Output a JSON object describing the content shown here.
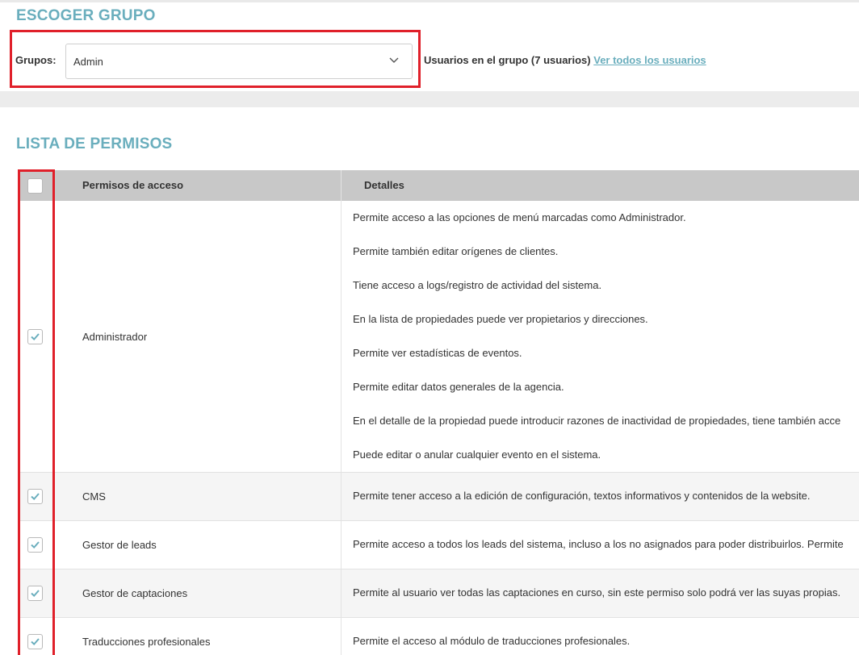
{
  "group_section": {
    "title": "ESCOGER GRUPO",
    "label": "Grupos:",
    "selected": "Admin",
    "users_text": "Usuarios en el grupo (7 usuarios)",
    "users_link": "Ver todos los usuarios"
  },
  "permissions_section": {
    "title": "LISTA DE PERMISOS",
    "headers": {
      "permission": "Permisos de acceso",
      "details": "Detalles"
    },
    "rows": [
      {
        "name": "Administrador",
        "checked": true,
        "details": [
          "Permite acceso a las opciones de menú marcadas como Administrador.",
          "Permite también editar orígenes de clientes.",
          "Tiene acceso a logs/registro de actividad del sistema.",
          "En la lista de propiedades puede ver propietarios y direcciones.",
          "Permite ver estadísticas de eventos.",
          "Permite editar datos generales de la agencia.",
          "En el detalle de la propiedad puede introducir razones de inactividad de propiedades, tiene también acce",
          "Puede editar o anular cualquier evento en el sistema."
        ]
      },
      {
        "name": "CMS",
        "checked": true,
        "details": [
          "Permite tener acceso a la edición de configuración, textos informativos y contenidos de la website."
        ]
      },
      {
        "name": "Gestor de leads",
        "checked": true,
        "details": [
          "Permite acceso a todos los leads del sistema, incluso a los no asignados para poder distribuirlos. Permite"
        ]
      },
      {
        "name": "Gestor de captaciones",
        "checked": true,
        "details": [
          "Permite al usuario ver todas las captaciones en curso, sin este permiso solo podrá ver las suyas propias."
        ]
      },
      {
        "name": "Traducciones profesionales",
        "checked": true,
        "details": [
          "Permite el acceso al módulo de traducciones profesionales."
        ]
      }
    ]
  },
  "colors": {
    "accent": "#6aaebd",
    "highlight": "#e0202a",
    "header_bg": "#c8c8c8"
  }
}
